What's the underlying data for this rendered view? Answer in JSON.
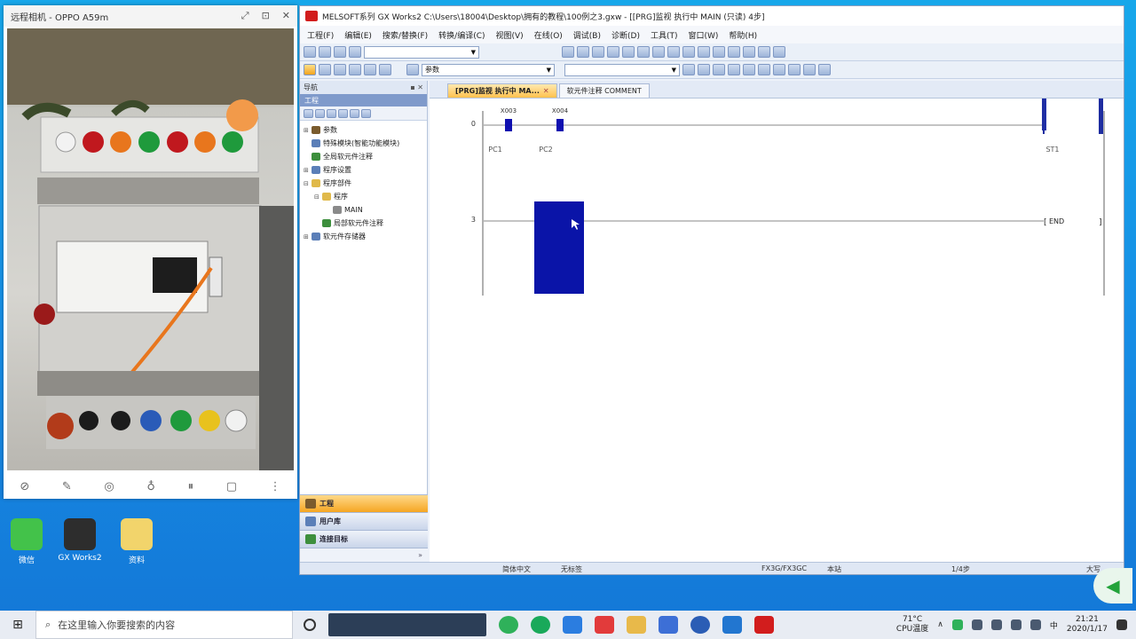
{
  "phone_window": {
    "title": "远程相机 - OPPO A59m",
    "controls": [
      "⤢",
      "⊡",
      "✕"
    ],
    "tools": [
      "link-icon",
      "brush-icon",
      "camera-icon",
      "bulb-icon",
      "pause-icon",
      "crop-icon",
      "more-icon"
    ]
  },
  "desktop_icons": [
    {
      "label": "微信",
      "color": "#43c24a"
    },
    {
      "label": "GX Works2",
      "color": "#2d2d2d"
    },
    {
      "label": "资料",
      "color": "#f2d46b"
    }
  ],
  "gx": {
    "title": "MELSOFT系列 GX Works2 C:\\Users\\18004\\Desktop\\拥有的教程\\100例之3.gxw - [[PRG]监视 执行中 MAIN (只读) 4步]",
    "menu": [
      "工程(F)",
      "编辑(E)",
      "搜索/替换(F)",
      "转换/编译(C)",
      "视图(V)",
      "在线(O)",
      "调试(B)",
      "诊断(D)",
      "工具(T)",
      "窗口(W)",
      "帮助(H)"
    ],
    "toolbar_combo": "参数",
    "nav": {
      "header": "导航",
      "header_controls": "▪ ✕",
      "subheader": "工程",
      "tree": [
        {
          "label": "参数",
          "indent": 0,
          "twist": "⊞",
          "color": "#7a5b2d"
        },
        {
          "label": "特殊模块(智能功能模块)",
          "indent": 0,
          "twist": "",
          "color": "#5b7fb8"
        },
        {
          "label": "全局软元件注释",
          "indent": 0,
          "twist": "",
          "color": "#3d8f3d"
        },
        {
          "label": "程序设置",
          "indent": 0,
          "twist": "⊞",
          "color": "#5b7fb8"
        },
        {
          "label": "程序部件",
          "indent": 0,
          "twist": "⊟",
          "color": "#e0b94a"
        },
        {
          "label": "程序",
          "indent": 1,
          "twist": "⊟",
          "color": "#e0b94a"
        },
        {
          "label": "MAIN",
          "indent": 2,
          "twist": "",
          "color": "#8a8a8a"
        },
        {
          "label": "局部软元件注释",
          "indent": 1,
          "twist": "",
          "color": "#3d8f3d"
        },
        {
          "label": "软元件存储器",
          "indent": 0,
          "twist": "⊞",
          "color": "#5b7fb8"
        }
      ],
      "bottom_tabs": [
        {
          "label": "工程",
          "active": true
        },
        {
          "label": "用户库",
          "active": false
        },
        {
          "label": "连接目标",
          "active": false
        }
      ],
      "footer": "»"
    },
    "tabs": [
      {
        "label": "[PRG]监视 执行中 MA...",
        "active": true,
        "close": "✕"
      },
      {
        "label": "软元件注释 COMMENT",
        "active": false,
        "close": ""
      }
    ],
    "ladder": {
      "rung0": {
        "step": "0",
        "contacts": [
          {
            "device": "X003",
            "comment": "PC1"
          },
          {
            "device": "X004",
            "comment": "PC2"
          }
        ],
        "coil_comment": "ST1"
      },
      "rung1": {
        "step": "3",
        "instruction": "END"
      }
    },
    "status": {
      "language": "简体中文",
      "label": "无标签",
      "plc": "FX3G/FX3GC",
      "station": "本站",
      "steps": "1/4步",
      "mode": "大写"
    }
  },
  "taskbar": {
    "search_placeholder": "在这里输入你要搜索的内容",
    "temperature": "71°C",
    "temperature_label": "CPU温度",
    "time": "21:21",
    "date": "2020/1/17",
    "apps": [
      {
        "name": "task-view-icon",
        "color": "#333333"
      },
      {
        "name": "qq-browser-icon",
        "color": "#2fb15a"
      },
      {
        "name": "green-app-icon",
        "color": "#19a95a"
      },
      {
        "name": "arrow-app-icon",
        "color": "#2b7de0"
      },
      {
        "name": "red-app-icon",
        "color": "#e23b3b"
      },
      {
        "name": "folder-icon",
        "color": "#e8b94a"
      },
      {
        "name": "store-icon",
        "color": "#3d6fd6"
      },
      {
        "name": "word-icon",
        "color": "#2b5db5"
      },
      {
        "name": "blue-app-icon",
        "color": "#2276d0"
      },
      {
        "name": "gxworks-icon",
        "color": "#d21d1d"
      }
    ]
  }
}
